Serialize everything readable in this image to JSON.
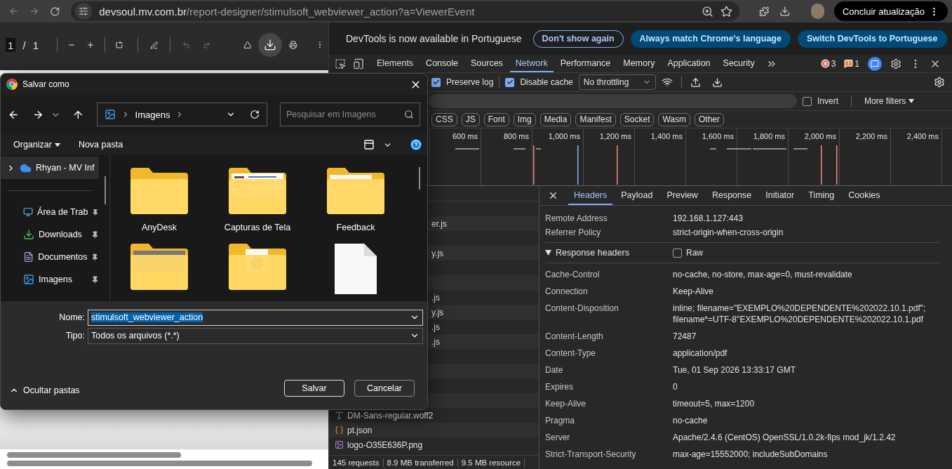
{
  "browser": {
    "url_host": "devsoul.mv.com.br",
    "url_path": "/report-designer/stimulsoft_webviewer_action?a=ViewerEvent",
    "update_button": "Concluir atualização"
  },
  "pdf_viewer": {
    "page_current": "1",
    "page_separator": "/",
    "page_total": "1"
  },
  "devtools": {
    "notice": {
      "text": "DevTools is now available in Portuguese",
      "buttons": [
        {
          "label": "Don't show again",
          "kind": "outline"
        },
        {
          "label": "Always match Chrome's language",
          "kind": "filled"
        },
        {
          "label": "Switch DevTools to Portuguese",
          "kind": "filled"
        }
      ]
    },
    "tabs": [
      {
        "label": "Elements",
        "selected": false
      },
      {
        "label": "Console",
        "selected": false
      },
      {
        "label": "Sources",
        "selected": false
      },
      {
        "label": "Network",
        "selected": true
      },
      {
        "label": "Performance",
        "selected": false
      },
      {
        "label": "Memory",
        "selected": false
      },
      {
        "label": "Application",
        "selected": false
      },
      {
        "label": "Security",
        "selected": false
      }
    ],
    "error_count": "3",
    "warning_count": "1",
    "network_toolbar": {
      "preserve_log": {
        "label": "Preserve log",
        "checked": true
      },
      "disable_cache": {
        "label": "Disable cache",
        "checked": true
      },
      "throttling": "No throttling"
    },
    "filter": {
      "invert": {
        "label": "Invert",
        "checked": false
      },
      "more_filters": "More filters"
    },
    "type_filters": [
      {
        "label": "CSS",
        "selected": false
      },
      {
        "label": "JS",
        "selected": false
      },
      {
        "label": "Font",
        "selected": false
      },
      {
        "label": "Img",
        "selected": false
      },
      {
        "label": "Media",
        "selected": false
      },
      {
        "label": "Manifest",
        "selected": false
      },
      {
        "label": "Socket",
        "selected": false
      },
      {
        "label": "Wasm",
        "selected": false
      },
      {
        "label": "Other",
        "selected": false
      }
    ],
    "timeline": {
      "ticks": [
        "600 ms",
        "800 ms",
        "1,000 ms",
        "1,200 ms",
        "1,400 ms",
        "1,600 ms",
        "1,800 ms",
        "2,000 ms",
        "2,200 ms",
        "2,400 ms"
      ]
    },
    "requests": [
      {
        "kind": "hidden"
      },
      {
        "kind": "clipped",
        "name": "er.js"
      },
      {
        "kind": "hidden"
      },
      {
        "kind": "clipped",
        "name": "y.js"
      },
      {
        "kind": "hidden"
      },
      {
        "kind": "hidden"
      },
      {
        "kind": "clipped",
        "name": ".js"
      },
      {
        "kind": "clipped",
        "name": "y.js"
      },
      {
        "kind": "clipped",
        "name": ".js"
      },
      {
        "kind": "clipped",
        "name": ".js"
      },
      {
        "kind": "hidden"
      },
      {
        "kind": "hidden"
      },
      {
        "kind": "hidden"
      },
      {
        "kind": "hidden"
      },
      {
        "kind": "font",
        "name": "DM-Sans-regular.woff2"
      },
      {
        "kind": "json",
        "name": "pt.json"
      },
      {
        "kind": "image",
        "name": "logo-O35E636P.png"
      }
    ],
    "status_bar": [
      "145 requests",
      "8.9 MB transferred",
      "9.5 MB resource"
    ],
    "details": {
      "tabs": [
        {
          "label": "Headers",
          "selected": true
        },
        {
          "label": "Payload",
          "selected": false
        },
        {
          "label": "Preview",
          "selected": false
        },
        {
          "label": "Response",
          "selected": false
        },
        {
          "label": "Initiator",
          "selected": false
        },
        {
          "label": "Timing",
          "selected": false
        },
        {
          "label": "Cookies",
          "selected": false
        }
      ],
      "general": [
        {
          "name": "Remote Address",
          "value": "192.168.1.127:443"
        },
        {
          "name": "Referrer Policy",
          "value": "strict-origin-when-cross-origin"
        }
      ],
      "response_section": {
        "title": "Response headers",
        "expanded": true,
        "raw": {
          "label": "Raw",
          "checked": false
        }
      },
      "response_headers": [
        {
          "name": "Cache-Control",
          "value": "no-cache, no-store, max-age=0, must-revalidate"
        },
        {
          "name": "Connection",
          "value": "Keep-Alive"
        },
        {
          "name": "Content-Disposition",
          "value": "inline; filename=\"EXEMPLO%20DEPENDENTE%202022.10.1.pdf\"; filename*=UTF-8''EXEMPLO%20DEPENDENTE%202022.10.1.pdf"
        },
        {
          "name": "Content-Length",
          "value": "72487"
        },
        {
          "name": "Content-Type",
          "value": "application/pdf"
        },
        {
          "name": "Date",
          "value": "Tue, 01 Sep 2026 13:33:17 GMT"
        },
        {
          "name": "Expires",
          "value": "0"
        },
        {
          "name": "Keep-Alive",
          "value": "timeout=5, max=1200"
        },
        {
          "name": "Pragma",
          "value": "no-cache"
        },
        {
          "name": "Server",
          "value": "Apache/2.4.6 (CentOS) OpenSSL/1.0.2k-fips mod_jk/1.2.42"
        },
        {
          "name": "Strict-Transport-Security",
          "value": "max-age=15552000; includeSubDomains"
        }
      ]
    }
  },
  "dialog": {
    "title": "Salvar como",
    "breadcrumb": "Imagens",
    "search_placeholder": "Pesquisar em Imagens",
    "organize": "Organizar",
    "new_folder": "Nova pasta",
    "nav_items": [
      {
        "label": "Rhyan - MV Inf",
        "kind": "cloud",
        "selected": true,
        "pinned": false
      },
      {
        "label": "Área de Trab",
        "kind": "desktop",
        "selected": false,
        "pinned": true
      },
      {
        "label": "Downloads",
        "kind": "downloads",
        "selected": false,
        "pinned": true
      },
      {
        "label": "Documentos",
        "kind": "documents",
        "selected": false,
        "pinned": true
      },
      {
        "label": "Imagens",
        "kind": "pictures",
        "selected": false,
        "pinned": true
      }
    ],
    "files": [
      {
        "name": "AnyDesk",
        "kind": "folder"
      },
      {
        "name": "Capturas de Tela",
        "kind": "folder-doc"
      },
      {
        "name": "Feedback",
        "kind": "folder-paper"
      },
      {
        "kind": "folder-photo"
      },
      {
        "kind": "folder-media"
      },
      {
        "kind": "file"
      }
    ],
    "name_field": {
      "label": "Nome:",
      "value": "stimulsoft_webviewer_action"
    },
    "type_field": {
      "label": "Tipo:",
      "value": "Todos os arquivos (*.*)"
    },
    "hide_folders": "Ocultar pastas",
    "buttons": [
      {
        "label": "Salvar",
        "kind": "primary"
      },
      {
        "label": "Cancelar",
        "kind": "secondary"
      }
    ]
  }
}
